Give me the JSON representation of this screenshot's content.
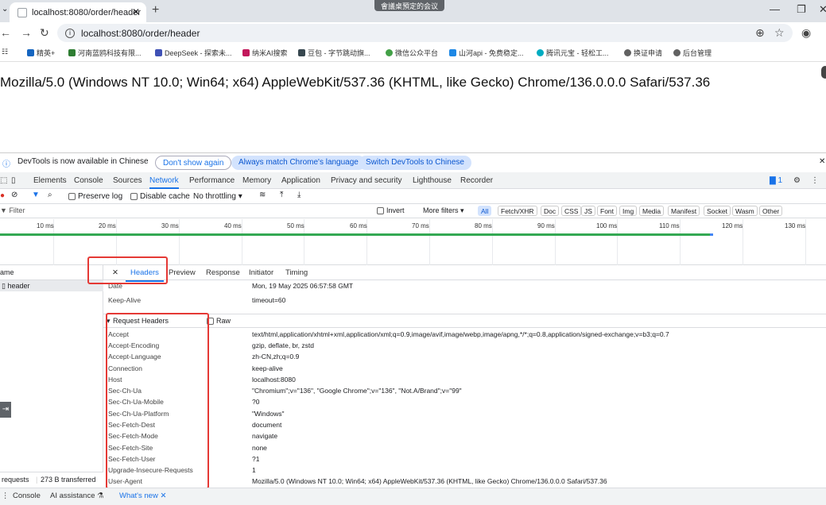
{
  "browser": {
    "tab_title": "localhost:8080/order/header",
    "meeting_banner": "會議桌預定的会议",
    "url": "localhost:8080/order/header"
  },
  "bookmarks": [
    "精英+",
    "河南蓝鸥科技有限...",
    "DeepSeek - 探索未...",
    "纳米AI搜索",
    "豆包 - 字节跳动旗...",
    "微信公众平台",
    "山河api - 免费稳定...",
    "腾讯元宝 - 轻松工...",
    "换证申请",
    "后台管理"
  ],
  "page": {
    "user_agent": "Mozilla/5.0 (Windows NT 10.0; Win64; x64) AppleWebKit/537.36 (KHTML, like Gecko) Chrome/136.0.0.0 Safari/537.36"
  },
  "devtools": {
    "info_text": "DevTools is now available in Chinese",
    "dont_show": "Don't show again",
    "always_match": "Always match Chrome's language",
    "switch_chinese": "Switch DevTools to Chinese",
    "tabs": [
      "Elements",
      "Console",
      "Sources",
      "Network",
      "Performance",
      "Memory",
      "Application",
      "Privacy and security",
      "Lighthouse",
      "Recorder"
    ],
    "issues_count": "1",
    "toolbar": {
      "preserve_log": "Preserve log",
      "disable_cache": "Disable cache",
      "throttling": "No throttling"
    },
    "filter": {
      "placeholder": "Filter",
      "invert": "Invert",
      "more_filters": "More filters",
      "types": [
        "All",
        "Fetch/XHR",
        "Doc",
        "CSS",
        "JS",
        "Font",
        "Img",
        "Media",
        "Manifest",
        "Socket",
        "Wasm",
        "Other"
      ]
    },
    "timeline_ticks": [
      "10 ms",
      "20 ms",
      "30 ms",
      "40 ms",
      "50 ms",
      "60 ms",
      "70 ms",
      "80 ms",
      "90 ms",
      "100 ms",
      "110 ms",
      "120 ms",
      "130 ms"
    ],
    "name_header": "ame",
    "request_name": "header",
    "detail_tabs": [
      "Headers",
      "Preview",
      "Response",
      "Initiator",
      "Timing"
    ],
    "response_headers": [
      {
        "k": "Date",
        "v": "Mon, 19 May 2025 06:57:58 GMT"
      },
      {
        "k": "Keep-Alive",
        "v": "timeout=60"
      }
    ],
    "request_headers_title": "Request Headers",
    "raw_label": "Raw",
    "request_headers": [
      {
        "k": "Accept",
        "v": "text/html,application/xhtml+xml,application/xml;q=0.9,image/avif,image/webp,image/apng,*/*;q=0.8,application/signed-exchange;v=b3;q=0.7"
      },
      {
        "k": "Accept-Encoding",
        "v": "gzip, deflate, br, zstd"
      },
      {
        "k": "Accept-Language",
        "v": "zh-CN,zh;q=0.9"
      },
      {
        "k": "Connection",
        "v": "keep-alive"
      },
      {
        "k": "Host",
        "v": "localhost:8080"
      },
      {
        "k": "Sec-Ch-Ua",
        "v": "\"Chromium\";v=\"136\", \"Google Chrome\";v=\"136\", \"Not.A/Brand\";v=\"99\""
      },
      {
        "k": "Sec-Ch-Ua-Mobile",
        "v": "?0"
      },
      {
        "k": "Sec-Ch-Ua-Platform",
        "v": "\"Windows\""
      },
      {
        "k": "Sec-Fetch-Dest",
        "v": "document"
      },
      {
        "k": "Sec-Fetch-Mode",
        "v": "navigate"
      },
      {
        "k": "Sec-Fetch-Site",
        "v": "none"
      },
      {
        "k": "Sec-Fetch-User",
        "v": "?1"
      },
      {
        "k": "Upgrade-Insecure-Requests",
        "v": "1"
      },
      {
        "k": "User-Agent",
        "v": "Mozilla/5.0 (Windows NT 10.0; Win64; x64) AppleWebKit/537.36 (KHTML, like Gecko) Chrome/136.0.0.0 Safari/537.36"
      }
    ],
    "status": {
      "requests": "requests",
      "transferred": "273 B transferred"
    },
    "drawer_tabs": [
      "Console",
      "AI assistance",
      "What's new"
    ]
  },
  "colors": {
    "accent": "#1a73e8",
    "highlight_box": "#e53935",
    "timeline_bar": "#34a853"
  }
}
